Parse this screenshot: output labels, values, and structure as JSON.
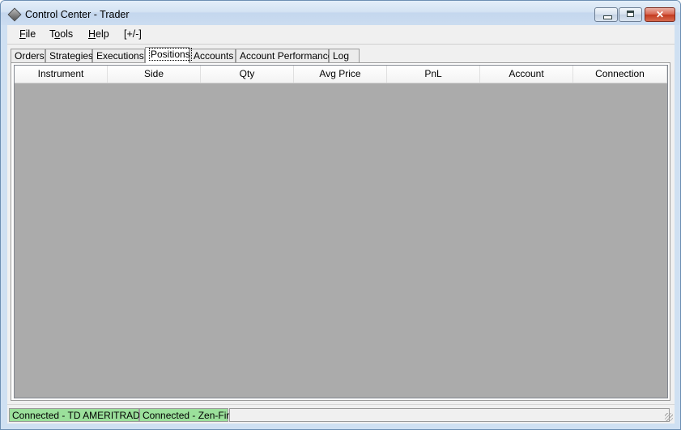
{
  "window": {
    "title": "Control Center - Trader"
  },
  "title_controls": {
    "minimize": "",
    "maximize": "",
    "close": "✕"
  },
  "menu": {
    "items": [
      {
        "label": "File",
        "mnemonic": "F"
      },
      {
        "label": "Tools",
        "mnemonic": "o"
      },
      {
        "label": "Help",
        "mnemonic": "H"
      },
      {
        "label": "[+/-]"
      }
    ]
  },
  "tabs": [
    {
      "label": "Orders",
      "active": false
    },
    {
      "label": "Strategies",
      "active": false
    },
    {
      "label": "Executions",
      "active": false
    },
    {
      "label": "Positions",
      "active": true
    },
    {
      "label": "Accounts",
      "active": false
    },
    {
      "label": "Account Performance",
      "active": false
    },
    {
      "label": "Log",
      "active": false
    }
  ],
  "grid": {
    "columns": [
      "Instrument",
      "Side",
      "Qty",
      "Avg Price",
      "PnL",
      "Account",
      "Connection"
    ],
    "rows": []
  },
  "status": [
    {
      "label": "Connected - TD AMERITRADE",
      "color": "#9be09b"
    },
    {
      "label": "Connected - Zen-Fire",
      "color": "#9be09b"
    },
    {
      "label": ""
    }
  ],
  "colors": {
    "grid_background": "#ababab",
    "connected": "#9be09b",
    "title_bar": "#d4e3f3"
  }
}
